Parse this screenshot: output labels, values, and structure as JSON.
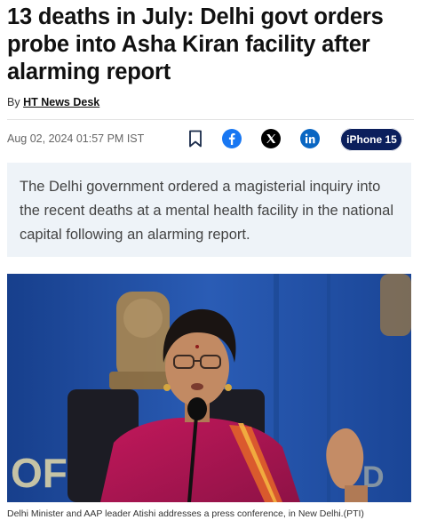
{
  "article": {
    "headline": "13 deaths in July: Delhi govt orders probe into Asha Kiran facility after alarming report",
    "byline_prefix": "By",
    "author": "HT News Desk",
    "timestamp": "Aug 02, 2024 01:57 PM IST",
    "summary": "The Delhi government ordered a magisterial inquiry into the recent deaths at a mental health facility in the national capital following an alarming report.",
    "photo_watermark": "OF",
    "caption": "Delhi Minister and AAP leader Atishi addresses a press conference, in New Delhi.(PTI)"
  },
  "share": {
    "promo_label": "iPhone 15",
    "icons": [
      "bookmark-icon",
      "facebook-icon",
      "x-icon",
      "linkedin-icon"
    ]
  },
  "colors": {
    "facebook": "#1877f2",
    "x": "#000000",
    "linkedin": "#0a66c2",
    "promo_bg": "#0b1f5c",
    "summary_bg": "#eef3f8"
  }
}
